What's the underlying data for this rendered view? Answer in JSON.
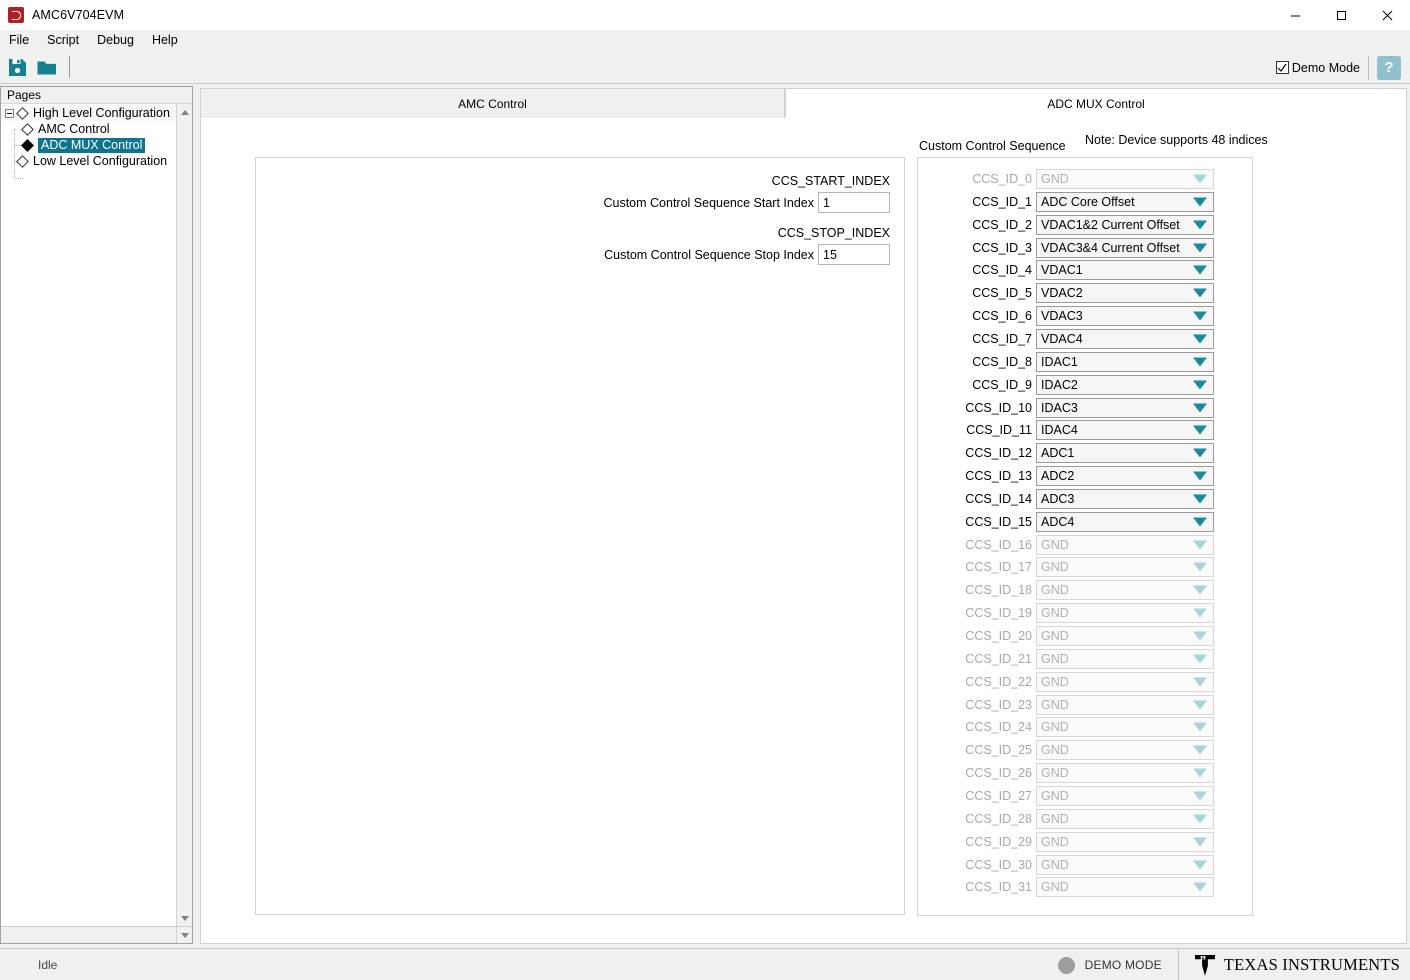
{
  "window": {
    "title": "AMC6V704EVM",
    "app_icon": "ti-app-icon",
    "minimize": "minimize-icon",
    "maximize": "maximize-icon",
    "close": "close-icon"
  },
  "menu": {
    "items": [
      {
        "label": "File"
      },
      {
        "label": "Script"
      },
      {
        "label": "Debug"
      },
      {
        "label": "Help"
      }
    ]
  },
  "toolbar": {
    "save_icon": "save-icon",
    "open_icon": "folder-open-icon",
    "demo_mode_label": "Demo Mode",
    "demo_mode_checked": true,
    "help_label": "?"
  },
  "sidebar": {
    "header": "Pages",
    "tree": [
      {
        "label": "High Level Configuration",
        "level": 0,
        "expanded": true,
        "selected": false,
        "marker": "diamond-outline-icon"
      },
      {
        "label": "AMC Control",
        "level": 1,
        "expanded": null,
        "selected": false,
        "marker": "diamond-outline-icon"
      },
      {
        "label": "ADC MUX Control",
        "level": 1,
        "expanded": null,
        "selected": true,
        "marker": "diamond-filled-icon"
      },
      {
        "label": "Low Level Configuration",
        "level": 0,
        "expanded": null,
        "selected": false,
        "marker": "diamond-outline-icon"
      }
    ],
    "scroll_up_icon": "scroll-up-arrow-icon",
    "scroll_down_icon": "scroll-down-arrow-icon",
    "hscroll_icon": "scroll-right-arrow-icon"
  },
  "tabs": [
    {
      "label": "AMC Control",
      "active": false
    },
    {
      "label": "ADC MUX Control",
      "active": true
    }
  ],
  "left_panel": {
    "start": {
      "register": "CCS_START_INDEX",
      "label": "Custom Control Sequence Start Index",
      "value": "1"
    },
    "stop": {
      "register": "CCS_STOP_INDEX",
      "label": "Custom Control Sequence Stop Index",
      "value": "15"
    }
  },
  "right_panel": {
    "title": "Custom Control Sequence",
    "note": "Note: Device supports 48 indices",
    "rows": [
      {
        "id": "CCS_ID_0",
        "value": "GND",
        "enabled": false
      },
      {
        "id": "CCS_ID_1",
        "value": "ADC Core Offset",
        "enabled": true
      },
      {
        "id": "CCS_ID_2",
        "value": "VDAC1&2 Current Offset",
        "enabled": true
      },
      {
        "id": "CCS_ID_3",
        "value": "VDAC3&4 Current Offset",
        "enabled": true
      },
      {
        "id": "CCS_ID_4",
        "value": "VDAC1",
        "enabled": true
      },
      {
        "id": "CCS_ID_5",
        "value": "VDAC2",
        "enabled": true
      },
      {
        "id": "CCS_ID_6",
        "value": "VDAC3",
        "enabled": true
      },
      {
        "id": "CCS_ID_7",
        "value": "VDAC4",
        "enabled": true
      },
      {
        "id": "CCS_ID_8",
        "value": "IDAC1",
        "enabled": true
      },
      {
        "id": "CCS_ID_9",
        "value": "IDAC2",
        "enabled": true
      },
      {
        "id": "CCS_ID_10",
        "value": "IDAC3",
        "enabled": true
      },
      {
        "id": "CCS_ID_11",
        "value": "IDAC4",
        "enabled": true
      },
      {
        "id": "CCS_ID_12",
        "value": "ADC1",
        "enabled": true
      },
      {
        "id": "CCS_ID_13",
        "value": "ADC2",
        "enabled": true
      },
      {
        "id": "CCS_ID_14",
        "value": "ADC3",
        "enabled": true
      },
      {
        "id": "CCS_ID_15",
        "value": "ADC4",
        "enabled": true
      },
      {
        "id": "CCS_ID_16",
        "value": "GND",
        "enabled": false
      },
      {
        "id": "CCS_ID_17",
        "value": "GND",
        "enabled": false
      },
      {
        "id": "CCS_ID_18",
        "value": "GND",
        "enabled": false
      },
      {
        "id": "CCS_ID_19",
        "value": "GND",
        "enabled": false
      },
      {
        "id": "CCS_ID_20",
        "value": "GND",
        "enabled": false
      },
      {
        "id": "CCS_ID_21",
        "value": "GND",
        "enabled": false
      },
      {
        "id": "CCS_ID_22",
        "value": "GND",
        "enabled": false
      },
      {
        "id": "CCS_ID_23",
        "value": "GND",
        "enabled": false
      },
      {
        "id": "CCS_ID_24",
        "value": "GND",
        "enabled": false
      },
      {
        "id": "CCS_ID_25",
        "value": "GND",
        "enabled": false
      },
      {
        "id": "CCS_ID_26",
        "value": "GND",
        "enabled": false
      },
      {
        "id": "CCS_ID_27",
        "value": "GND",
        "enabled": false
      },
      {
        "id": "CCS_ID_28",
        "value": "GND",
        "enabled": false
      },
      {
        "id": "CCS_ID_29",
        "value": "GND",
        "enabled": false
      },
      {
        "id": "CCS_ID_30",
        "value": "GND",
        "enabled": false
      },
      {
        "id": "CCS_ID_31",
        "value": "GND",
        "enabled": false
      }
    ]
  },
  "statusbar": {
    "status": "Idle",
    "demo_mode": "DEMO MODE",
    "brand": "TEXAS INSTRUMENTS"
  },
  "colors": {
    "accent": "#0e7490",
    "teal_icon": "#16828f",
    "arrow": "#1a8a9e",
    "arrow_disabled": "#a9d4dc",
    "selection": "#0e7490",
    "app_icon_red": "#b21f24",
    "help_blue": "#8fc0cc"
  }
}
